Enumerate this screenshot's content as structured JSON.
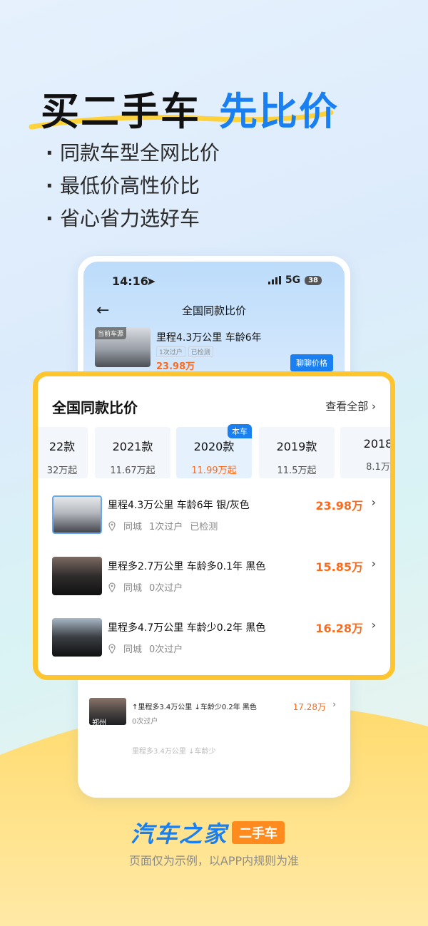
{
  "hero": {
    "headline_dark": "买二手车",
    "headline_blue": "先比价",
    "bullets": [
      "同款车型全网比价",
      "最低价高性价比",
      "省心省力选好车"
    ]
  },
  "phone": {
    "status": {
      "time": "14:16",
      "network": "5G",
      "battery": "38"
    },
    "nav_title": "全国同款比价",
    "current_car": {
      "tag": "当前车源",
      "title": "里程4.3万公里 车龄6年",
      "tags": [
        "1次过户",
        "已检测"
      ],
      "price": "23.98万",
      "chat_button": "聊聊价格"
    },
    "lower_row": {
      "city": "郑州",
      "title": "↑里程多3.4万公里 ↓车龄少0.2年 黑色",
      "sub": "0次过户",
      "price": "17.28万"
    },
    "fade_row": "里程多3.4万公里 ↓车龄少"
  },
  "card": {
    "title": "全国同款比价",
    "see_all": "查看全部",
    "years": [
      {
        "label": "22款",
        "price": "32万起"
      },
      {
        "label": "2021款",
        "price": "11.67万起"
      },
      {
        "label": "2020款",
        "price": "11.99万起",
        "badge": "本车"
      },
      {
        "label": "2019款",
        "price": "11.5万起"
      },
      {
        "label": "2018",
        "price": "8.1万"
      }
    ],
    "items": [
      {
        "title": "里程4.3万公里 车龄6年 银/灰色",
        "city": "同城",
        "meta": [
          "1次过户",
          "已检测"
        ],
        "price": "23.98万"
      },
      {
        "title": "里程多2.7万公里 车龄多0.1年 黑色",
        "city": "同城",
        "meta": [
          "0次过户"
        ],
        "price": "15.85万"
      },
      {
        "title": "里程多4.7万公里 车龄少0.2年 黑色",
        "city": "同城",
        "meta": [
          "0次过户"
        ],
        "price": "16.28万"
      }
    ]
  },
  "brand": {
    "logo_main": "汽车之家",
    "logo_badge": "二手车",
    "footnote": "页面仅为示例，以APP内规则为准"
  },
  "colors": {
    "accent_blue": "#1a7ff0",
    "price_orange": "#ff6a1a",
    "card_border": "#ffc52e",
    "badge_orange": "#ff8a1e"
  }
}
